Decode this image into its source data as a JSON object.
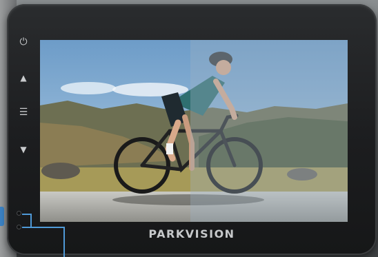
{
  "device": {
    "brand": "PARKVISION",
    "buttons": [
      {
        "name": "power-icon",
        "glyph": "⏻"
      },
      {
        "name": "up-arrow-icon",
        "glyph": "▲"
      },
      {
        "name": "menu-list-icon",
        "glyph": "☰"
      },
      {
        "name": "down-arrow-icon",
        "glyph": "▼"
      }
    ],
    "accent_color": "#4f9ad8"
  },
  "screen": {
    "scene": "cyclist-photo",
    "day_night_split": true
  }
}
